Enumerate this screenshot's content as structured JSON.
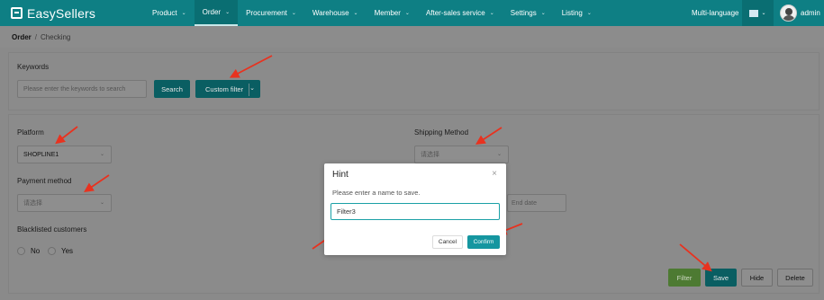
{
  "brand": {
    "name": "EasySellers"
  },
  "nav": {
    "items": [
      {
        "label": "Product"
      },
      {
        "label": "Order"
      },
      {
        "label": "Procurement"
      },
      {
        "label": "Warehouse"
      },
      {
        "label": "Member"
      },
      {
        "label": "After-sales service"
      },
      {
        "label": "Settings"
      },
      {
        "label": "Listing"
      }
    ],
    "active_item": "Order",
    "chevron": "⌄",
    "multi_language": "Multi-language",
    "user": "admin"
  },
  "breadcrumb": {
    "root": "Order",
    "separator": "/",
    "current": "Checking"
  },
  "search_panel": {
    "keywords_label": "Keywords",
    "keywords_placeholder": "Please enter the keywords to search",
    "search_button": "Search",
    "custom_filter_button": "Custom filter"
  },
  "filter_panel": {
    "platform_label": "Platform",
    "platform_value": "SHOPLINE1",
    "payment_label": "Payment method",
    "payment_value": "请选择",
    "blacklist_label": "Blacklisted customers",
    "radio_no": "No",
    "radio_yes": "Yes",
    "shipping_label": "Shipping Method",
    "shipping_value": "请选择",
    "end_date_placeholder": "End date",
    "buttons": {
      "filter": "Filter",
      "save": "Save",
      "hide": "Hide",
      "delete": "Delete"
    }
  },
  "dialog": {
    "title": "Hint",
    "close": "×",
    "message": "Please enter a name to save.",
    "input_value": "Filter3",
    "cancel": "Cancel",
    "confirm": "Confirm"
  },
  "colors": {
    "accent": "#0e7f84",
    "annotation_arrow": "#e8321f",
    "confirm": "#1596a0"
  }
}
